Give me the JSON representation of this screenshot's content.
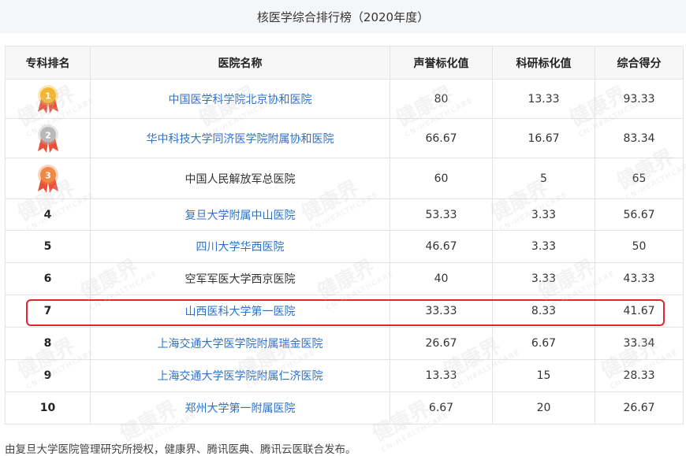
{
  "page": {
    "title": "核医学综合排行榜（2020年度）",
    "footer": "由复旦大学医院管理研究所授权，健康界、腾讯医典、腾讯云医联合发布。"
  },
  "watermark": {
    "main": "健康界",
    "sub": "CN-HEALTHCARE"
  },
  "table": {
    "headers": [
      "专科排名",
      "医院名称",
      "声誉标化值",
      "科研标化值",
      "综合得分"
    ],
    "rows": [
      {
        "rank": "1",
        "medal": "gold-medal-icon",
        "hospital": "中国医学科学院北京协和医院",
        "link": true,
        "reputation": "80",
        "research": "13.33",
        "score": "93.33"
      },
      {
        "rank": "2",
        "medal": "silver-medal-icon",
        "hospital": "华中科技大学同济医学院附属协和医院",
        "link": true,
        "reputation": "66.67",
        "research": "16.67",
        "score": "83.34"
      },
      {
        "rank": "3",
        "medal": "bronze-medal-icon",
        "hospital": "中国人民解放军总医院",
        "link": false,
        "reputation": "60",
        "research": "5",
        "score": "65"
      },
      {
        "rank": "4",
        "hospital": "复旦大学附属中山医院",
        "link": true,
        "reputation": "53.33",
        "research": "3.33",
        "score": "56.67"
      },
      {
        "rank": "5",
        "hospital": "四川大学华西医院",
        "link": true,
        "reputation": "46.67",
        "research": "3.33",
        "score": "50"
      },
      {
        "rank": "6",
        "hospital": "空军军医大学西京医院",
        "link": false,
        "reputation": "40",
        "research": "3.33",
        "score": "43.33"
      },
      {
        "rank": "7",
        "hospital": "山西医科大学第一医院",
        "link": true,
        "reputation": "33.33",
        "research": "8.33",
        "score": "41.67",
        "highlighted": true
      },
      {
        "rank": "8",
        "hospital": "上海交通大学医学院附属瑞金医院",
        "link": true,
        "reputation": "26.67",
        "research": "6.67",
        "score": "33.34"
      },
      {
        "rank": "9",
        "hospital": "上海交通大学医学院附属仁济医院",
        "link": true,
        "reputation": "13.33",
        "research": "15",
        "score": "28.33"
      },
      {
        "rank": "10",
        "hospital": "郑州大学第一附属医院",
        "link": true,
        "reputation": "6.67",
        "research": "20",
        "score": "26.67"
      }
    ]
  },
  "colors": {
    "link": "#2f72c8",
    "highlight_border": "#e6232e",
    "gold": "#f3b62c",
    "silver": "#b9b9b9",
    "bronze": "#ee8a45",
    "ribbon": "#e8513a"
  }
}
